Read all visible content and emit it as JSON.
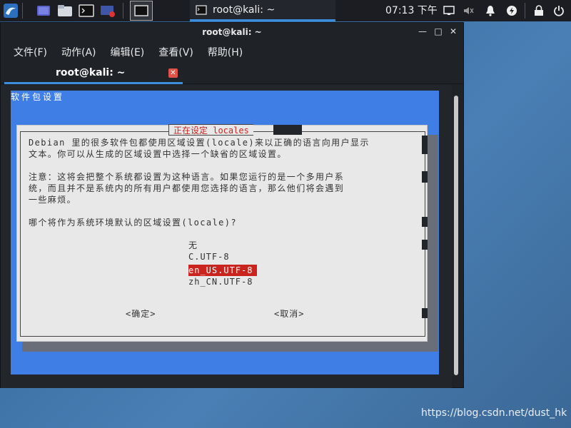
{
  "taskbar": {
    "task_label": "root@kali: ~",
    "clock": "07:13 下午",
    "launchers": [
      "kali-menu-icon",
      "workspace-icon",
      "file-manager-icon",
      "terminal-icon",
      "screen-recorder-icon"
    ],
    "tray": [
      "display-icon",
      "volume-muted-icon",
      "notification-bell-icon",
      "power-manager-icon",
      "lock-icon",
      "power-icon"
    ]
  },
  "window": {
    "title": "root@kali: ~",
    "controls": [
      "—",
      "□",
      "✕"
    ],
    "menu": [
      "文件(F)",
      "动作(A)",
      "编辑(E)",
      "查看(V)",
      "帮助(H)"
    ],
    "tab_label": "root@kali: ~",
    "tab_close": "✕"
  },
  "installer": {
    "header": "软件包设置",
    "dialog_title": "正在设定 locales",
    "paragraph1_line1": "Debian 里的很多软件包都使用区域设置(locale)来以正确的语言向用户显示",
    "paragraph1_line2": "文本。你可以从生成的区域设置中选择一个缺省的区域设置。",
    "paragraph2_line1": "注意：这将会把整个系统都设置为这种语言。如果您运行的是一个多用户系",
    "paragraph2_line2": "统，而且并不是系统内的所有用户都使用您选择的语言，那么他们将会遇到",
    "paragraph2_line3": "一些麻烦。",
    "question": "哪个将作为系统环境默认的区域设置(locale)?",
    "options": [
      "无",
      "C.UTF-8",
      "en_US.UTF-8",
      "zh_CN.UTF-8"
    ],
    "selected_index": 2,
    "ok_button": "<确定>",
    "cancel_button": "<取消>"
  },
  "watermark": "https://blog.csdn.net/dust_hk",
  "colors": {
    "accent": "#3c8ddd",
    "installer_bg": "#3f7fe5",
    "selection": "#c9241e",
    "dialog_bg": "#e8e8e8"
  }
}
